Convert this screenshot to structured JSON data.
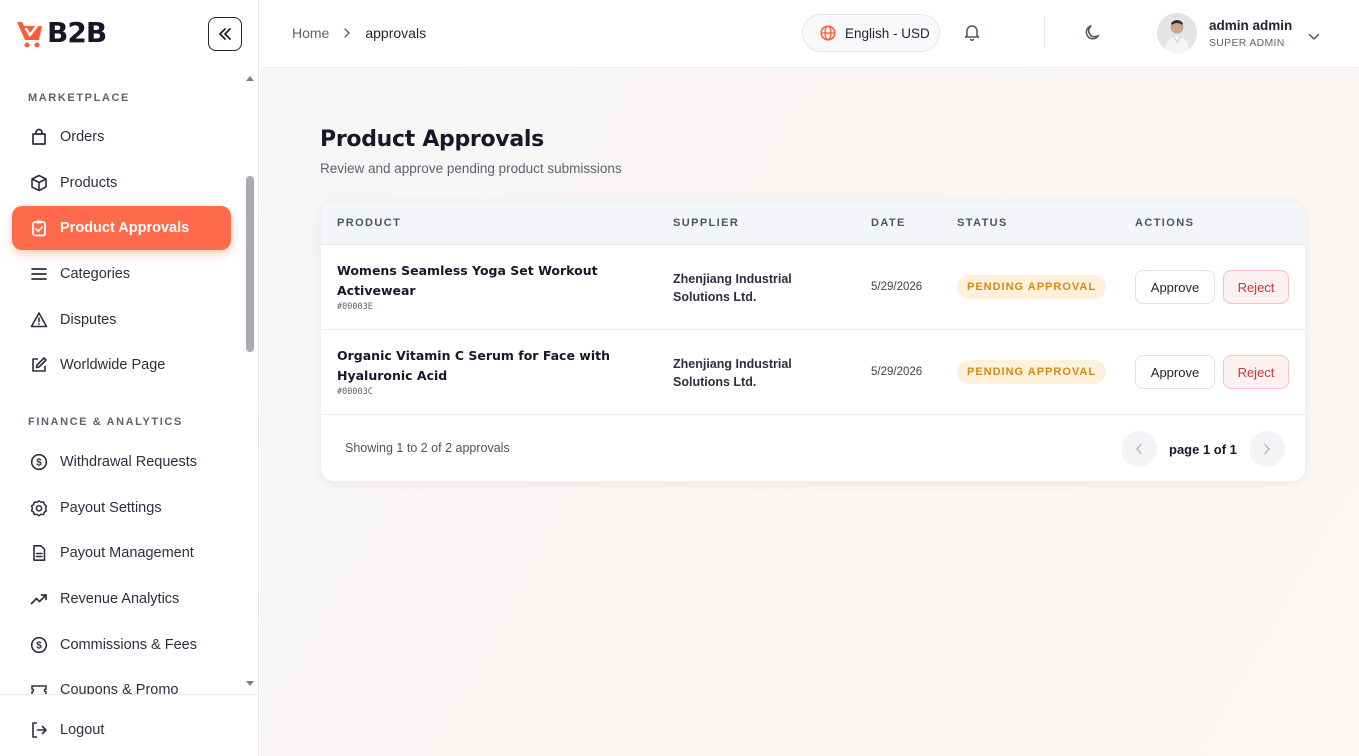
{
  "app": {
    "logo_text": "B2B"
  },
  "sidebar": {
    "sections": [
      {
        "title": "MARKETPLACE"
      },
      {
        "title": "FINANCE & ANALYTICS"
      }
    ],
    "items": [
      {
        "label": "Orders",
        "icon": "shopping-bag-icon"
      },
      {
        "label": "Products",
        "icon": "box-icon"
      },
      {
        "label": "Product Approvals",
        "icon": "clipboard-check-icon",
        "active": true
      },
      {
        "label": "Categories",
        "icon": "list-icon"
      },
      {
        "label": "Disputes",
        "icon": "alert-triangle-icon"
      },
      {
        "label": "Worldwide Page",
        "icon": "edit-icon"
      },
      {
        "label": "Withdrawal Requests",
        "icon": "dollar-circle-icon"
      },
      {
        "label": "Payout Settings",
        "icon": "gear-icon"
      },
      {
        "label": "Payout Management",
        "icon": "document-icon"
      },
      {
        "label": "Revenue Analytics",
        "icon": "trending-up-icon"
      },
      {
        "label": "Commissions & Fees",
        "icon": "dollar-circle-icon"
      },
      {
        "label": "Coupons & Promo",
        "icon": "ticket-icon"
      }
    ],
    "logout_label": "Logout"
  },
  "header": {
    "breadcrumb": {
      "home": "Home",
      "current": "approvals"
    },
    "language": "English - USD",
    "user": {
      "name": "admin admin",
      "role": "SUPER ADMIN"
    }
  },
  "page": {
    "title": "Product Approvals",
    "subtitle": "Review and approve pending product submissions"
  },
  "table": {
    "columns": [
      "PRODUCT",
      "SUPPLIER",
      "DATE",
      "STATUS",
      "ACTIONS"
    ],
    "rows": [
      {
        "product_line1": "Womens Seamless Yoga Set Workout",
        "product_line2": "Activewear",
        "id": "#00003E",
        "supplier_line1": "Zhenjiang Industrial",
        "supplier_line2": "Solutions Ltd.",
        "date": "5/29/2026",
        "status": "PENDING APPROVAL",
        "approve_label": "Approve",
        "reject_label": "Reject"
      },
      {
        "product_line1": "Organic Vitamin C Serum for Face with",
        "product_line2": "Hyaluronic Acid",
        "id": "#00003C",
        "supplier_line1": "Zhenjiang Industrial",
        "supplier_line2": "Solutions Ltd.",
        "date": "5/29/2026",
        "status": "PENDING APPROVAL",
        "approve_label": "Approve",
        "reject_label": "Reject"
      }
    ],
    "footer": "Showing 1 to 2 of 2 approvals",
    "pagination": "page 1 of 1"
  },
  "colors": {
    "accent": "#ff6a4a",
    "status_pending_bg": "#fdf1dc",
    "status_pending_text": "#d78a12",
    "reject": "#c93a3a"
  }
}
